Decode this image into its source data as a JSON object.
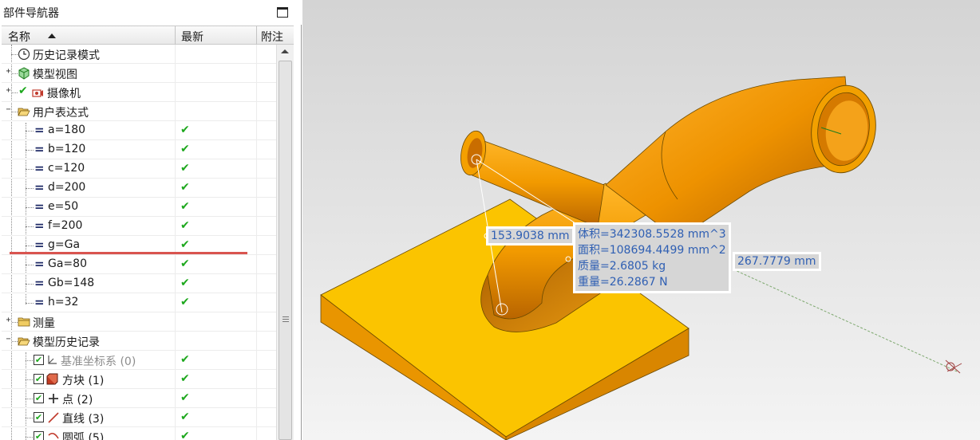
{
  "navigator": {
    "title": "部件导航器",
    "columns": {
      "name": "名称",
      "latest": "最新",
      "note": "附注"
    },
    "items": [
      {
        "label": "历史记录模式",
        "icon": "clock-icon"
      },
      {
        "label": "模型视图",
        "icon": "model-view-icon"
      },
      {
        "label": "摄像机",
        "icon": "camera-icon"
      },
      {
        "label": "用户表达式",
        "icon": "folder-open-icon"
      },
      {
        "label": "a=180",
        "latest": "✔"
      },
      {
        "label": "b=120",
        "latest": "✔"
      },
      {
        "label": "c=120",
        "latest": "✔"
      },
      {
        "label": "d=200",
        "latest": "✔"
      },
      {
        "label": "e=50",
        "latest": "✔"
      },
      {
        "label": "f=200",
        "latest": "✔"
      },
      {
        "label": "g=Ga",
        "latest": "✔"
      },
      {
        "label": "Ga=80",
        "latest": "✔"
      },
      {
        "label": "Gb=148",
        "latest": "✔"
      },
      {
        "label": "h=32",
        "latest": "✔"
      },
      {
        "label": "测量",
        "icon": "folder-icon"
      },
      {
        "label": "模型历史记录",
        "icon": "folder-open-icon"
      },
      {
        "label": "基准坐标系 (0)",
        "latest": "✔"
      },
      {
        "label": "方块 (1)",
        "latest": "✔"
      },
      {
        "label": "点 (2)",
        "latest": "✔"
      },
      {
        "label": "直线 (3)",
        "latest": "✔"
      },
      {
        "label": "圆弧 (5)",
        "latest": "✔"
      }
    ],
    "eq_symbol": "=",
    "checkbox_mark": "✔",
    "expand_plus": "+",
    "expand_minus": "−"
  },
  "viewport": {
    "dim_left": "153.9038 mm",
    "dim_right": "267.7779 mm",
    "properties": {
      "volume": "体积=342308.5528 mm^3",
      "area": "面积=108694.4499 mm^2",
      "mass": "质量=2.6805 kg",
      "weight": "重量=26.2867 N"
    }
  },
  "colors": {
    "base_top": "#fbc400",
    "base_side": "#e99500",
    "pipe_light": "#ffae1a",
    "pipe_dark": "#c87000",
    "check_green": "#1da81d",
    "dim_text": "#2f5fb3",
    "annotation_line": "#d9544f"
  }
}
